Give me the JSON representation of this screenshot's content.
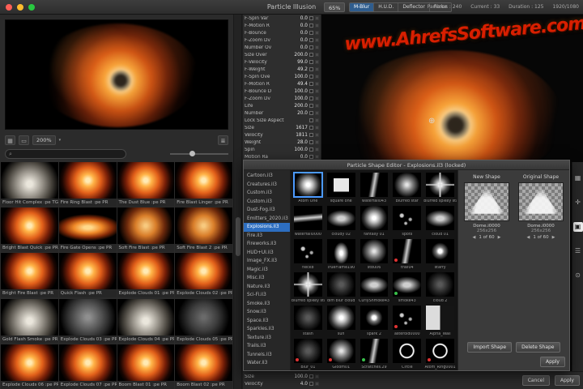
{
  "window": {
    "title": "Particle Illusion"
  },
  "icons": {
    "search": "⌕",
    "caret": "▾",
    "crosshair": "⊕",
    "grid": "▦",
    "monitor": "▭",
    "list": "≣"
  },
  "topbar": {
    "zoom": "65%",
    "segments": [
      {
        "label": "M-Blur",
        "state": "active"
      },
      {
        "label": "H.U.D.",
        "state": ""
      },
      {
        "label": "Deflector",
        "state": ""
      },
      {
        "label": "Force",
        "state": ""
      }
    ],
    "stats": [
      {
        "text": "Particles : 240"
      },
      {
        "text": "Current : 33"
      },
      {
        "text": "Duration : 125"
      },
      {
        "text": "1920/1080"
      }
    ]
  },
  "watermark": "www.AhrefsSoftware.com",
  "preview": {
    "zoom": "200%"
  },
  "params": {
    "rows": [
      {
        "name": "F-Spin Var",
        "value": "0.0"
      },
      {
        "name": "F-Motion R",
        "value": "0.0"
      },
      {
        "name": "F-Bounce",
        "value": "0.0"
      },
      {
        "name": "F-Zoom Dv",
        "value": "0.0"
      },
      {
        "name": "Number Ov",
        "value": "0.0"
      },
      {
        "name": "Size Over",
        "value": "200.0"
      },
      {
        "name": "F-Velocity",
        "value": "99.0"
      },
      {
        "name": "F-Weight",
        "value": "49.2"
      },
      {
        "name": "F-Spin Ove",
        "value": "100.0"
      },
      {
        "name": "F-Motion R",
        "value": "49.4"
      },
      {
        "name": "F-Bounce D",
        "value": "100.0"
      },
      {
        "name": "F-Zoom Dv",
        "value": "100.0"
      },
      {
        "name": "Life",
        "value": "200.0"
      },
      {
        "name": "Number",
        "value": "20.0"
      },
      {
        "name": "Lock Size Aspect",
        "value": ""
      },
      {
        "name": "Size",
        "value": "1617"
      },
      {
        "name": "Velocity",
        "value": "1811"
      },
      {
        "name": "Weight",
        "value": "28.0"
      },
      {
        "name": "Spin",
        "value": "100.0"
      },
      {
        "name": "Motion Ra",
        "value": "0.0"
      }
    ]
  },
  "library": {
    "items": [
      {
        "label": "Floor Hit Complex :pe TG",
        "variant": "puff",
        "state": ""
      },
      {
        "label": "Fire Ring Blast :pe PR",
        "variant": "fire",
        "state": ""
      },
      {
        "label": "The Dust Blue :pe PR",
        "variant": "fire",
        "state": "selected"
      },
      {
        "label": "Fire Blast Linger :pe PR",
        "variant": "fire",
        "state": ""
      },
      {
        "label": "Bright Blast Quick :pe PR",
        "variant": "fire",
        "state": ""
      },
      {
        "label": "Fire Gate Opens :pe PR",
        "variant": "firewide",
        "state": ""
      },
      {
        "label": "Soft Fire Blast :pe PR",
        "variant": "firesoft",
        "state": ""
      },
      {
        "label": "Soft Fire Blast 2 :pe PR",
        "variant": "firesoft",
        "state": ""
      },
      {
        "label": "Bright Fire Blast :pe PR",
        "variant": "fire",
        "state": ""
      },
      {
        "label": "Quick Flash :pe PR",
        "variant": "fire",
        "state": ""
      },
      {
        "label": "Explode Clouds 01 :pe PR",
        "variant": "fire",
        "state": ""
      },
      {
        "label": "Explode Clouds 02 :pe PR",
        "variant": "fire",
        "state": ""
      },
      {
        "label": "Gold Flash Smoke :pe PR",
        "variant": "puff",
        "state": ""
      },
      {
        "label": "Explode Clouds 03 :pe PR",
        "variant": "smoke",
        "state": ""
      },
      {
        "label": "Explode Clouds 04 :pe PR",
        "variant": "puff",
        "state": ""
      },
      {
        "label": "Explode Clouds 05 :pe PR",
        "variant": "smokedark",
        "state": ""
      },
      {
        "label": "Explode Clouds 06 :pe PR",
        "variant": "fire",
        "state": ""
      },
      {
        "label": "Explode Clouds 07 :pe PR",
        "variant": "fire",
        "state": ""
      },
      {
        "label": "Boom Blast 01 :pe PR",
        "variant": "fire",
        "state": ""
      },
      {
        "label": "Boom Blast 02 :pe PR",
        "variant": "fire",
        "state": ""
      }
    ]
  },
  "rail": {
    "icons": [
      {
        "glyph": "▦",
        "state": ""
      },
      {
        "glyph": "✛",
        "state": ""
      },
      {
        "glyph": "▣",
        "state": "active"
      },
      {
        "glyph": "☰",
        "state": ""
      },
      {
        "glyph": "⊙",
        "state": ""
      }
    ]
  },
  "dialog": {
    "title": "Particle Shape Editor - Explosions.il3 (locked)",
    "libraries": [
      {
        "label": "Cartoon.il3",
        "state": ""
      },
      {
        "label": "Creatures.il3",
        "state": ""
      },
      {
        "label": "Custom.il3",
        "state": ""
      },
      {
        "label": "Custom.il3",
        "state": ""
      },
      {
        "label": "Dust-Fog.il3",
        "state": ""
      },
      {
        "label": "Emitters_2020.il3",
        "state": ""
      },
      {
        "label": "Explosions.il3",
        "state": "selected"
      },
      {
        "label": "Fire.il3",
        "state": ""
      },
      {
        "label": "Fireworks.il3",
        "state": ""
      },
      {
        "label": "HUD+UI.il3",
        "state": ""
      },
      {
        "label": "Image_FX.il3",
        "state": ""
      },
      {
        "label": "Magic.il3",
        "state": ""
      },
      {
        "label": "Misc.il3",
        "state": ""
      },
      {
        "label": "Nature.il3",
        "state": ""
      },
      {
        "label": "Sci-Fi.il3",
        "state": ""
      },
      {
        "label": "Smoke.il3",
        "state": ""
      },
      {
        "label": "Snow.il3",
        "state": ""
      },
      {
        "label": "Space.il3",
        "state": ""
      },
      {
        "label": "Sparkles.il3",
        "state": ""
      },
      {
        "label": "Texture.il3",
        "state": ""
      },
      {
        "label": "Trails.il3",
        "state": ""
      },
      {
        "label": "Tunnels.il3",
        "state": ""
      },
      {
        "label": "Water.il3",
        "state": ""
      }
    ],
    "shapes": [
      {
        "label": "Atom One",
        "variant": "blob",
        "state": "selected",
        "dot": ""
      },
      {
        "label": "square one",
        "variant": "square",
        "state": "",
        "dot": ""
      },
      {
        "label": "waterfall043",
        "variant": "streak",
        "state": "",
        "dot": ""
      },
      {
        "label": "blurred star",
        "variant": "softblob",
        "state": "",
        "dot": ""
      },
      {
        "label": "blurred spikey star",
        "variant": "spikes",
        "state": "",
        "dot": ""
      },
      {
        "label": "waterfall0000",
        "variant": "streakv",
        "state": "",
        "dot": ""
      },
      {
        "label": "cloudy 02",
        "variant": "cloud",
        "state": "",
        "dot": ""
      },
      {
        "label": "fantasy 01",
        "variant": "blob",
        "state": "",
        "dot": ""
      },
      {
        "label": "spots",
        "variant": "dots",
        "state": "",
        "dot": ""
      },
      {
        "label": "cloud 01",
        "variant": "cloud",
        "state": "",
        "dot": ""
      },
      {
        "label": "fleck8",
        "variant": "dots",
        "state": "",
        "dot": ""
      },
      {
        "label": "TrueFlame190",
        "variant": "flame",
        "state": "",
        "dot": ""
      },
      {
        "label": "stbu06",
        "variant": "softblob",
        "state": "",
        "dot": ""
      },
      {
        "label": "trail04",
        "variant": "streak",
        "state": "",
        "dot": "red"
      },
      {
        "label": "starry",
        "variant": "star",
        "state": "",
        "dot": ""
      },
      {
        "label": "blurred spikey star 2",
        "variant": "spikes",
        "state": "",
        "dot": ""
      },
      {
        "label": "dim blur cloud",
        "variant": "dim",
        "state": "",
        "dot": ""
      },
      {
        "label": "CurlyShmoke43",
        "variant": "cloud",
        "state": "",
        "dot": ""
      },
      {
        "label": "smoke43",
        "variant": "cloud",
        "state": "",
        "dot": "green"
      },
      {
        "label": "cloud 2",
        "variant": "dim",
        "state": "",
        "dot": ""
      },
      {
        "label": "stash",
        "variant": "dim",
        "state": "",
        "dot": ""
      },
      {
        "label": "sun",
        "variant": "blob",
        "state": "",
        "dot": ""
      },
      {
        "label": "spark 2",
        "variant": "star",
        "state": "",
        "dot": ""
      },
      {
        "label": "asteroid0000",
        "variant": "dots",
        "state": "",
        "dot": "red"
      },
      {
        "label": "Alpha_Wall",
        "variant": "alpha",
        "state": "",
        "dot": ""
      },
      {
        "label": "Blur_01",
        "variant": "dim",
        "state": "",
        "dot": "red"
      },
      {
        "label": "Gloom01",
        "variant": "softblob",
        "state": "",
        "dot": "red"
      },
      {
        "label": "Scratches.29",
        "variant": "streak",
        "state": "",
        "dot": "green"
      },
      {
        "label": "Circle",
        "variant": "ringline",
        "state": "",
        "dot": ""
      },
      {
        "label": "Atom_Ring0001",
        "variant": "ringline",
        "state": "",
        "dot": "red"
      }
    ],
    "new_shape_label": "New Shape",
    "original_shape_label": "Original Shape",
    "shape_file": "Dome.i0000",
    "shape_size": "256x256",
    "pager": "1 of 60",
    "prev": "◀",
    "next": "▶",
    "import_label": "Import Shape",
    "delete_label": "Delete Shape",
    "apply_label": "Apply"
  },
  "bottom": {
    "params": [
      {
        "name": "Size",
        "value": "100.0"
      },
      {
        "name": "Velocity",
        "value": "4.0"
      }
    ],
    "cancel": "Cancel",
    "apply": "Apply"
  }
}
